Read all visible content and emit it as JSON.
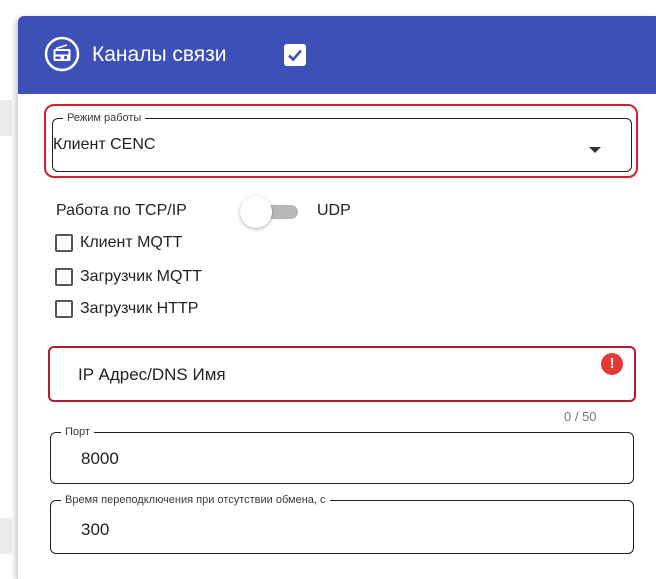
{
  "header": {
    "title": "Каналы связи",
    "icon": "radio-icon",
    "checked": true,
    "background": "#3d50b8"
  },
  "mode": {
    "legend": "Режим работы",
    "value": "Клиент CENC",
    "highlight_color": "#d61f2a"
  },
  "transport": {
    "left_label": "Работа по TCP/IP",
    "right_label": "UDP",
    "udp_enabled": false
  },
  "options": [
    {
      "label": "Клиент MQTT",
      "checked": false
    },
    {
      "label": "Загрузчик MQTT",
      "checked": false
    },
    {
      "label": "Загрузчик HTTP",
      "checked": false
    }
  ],
  "address": {
    "placeholder": "IP Адрес/DNS Имя",
    "counter": "0 / 50",
    "error_mark": "!",
    "error_color": "#e53935"
  },
  "port": {
    "legend": "Порт",
    "value": "8000"
  },
  "reconnect": {
    "legend": "Время переподключения при отсутствии обмена, с",
    "value": "300"
  }
}
